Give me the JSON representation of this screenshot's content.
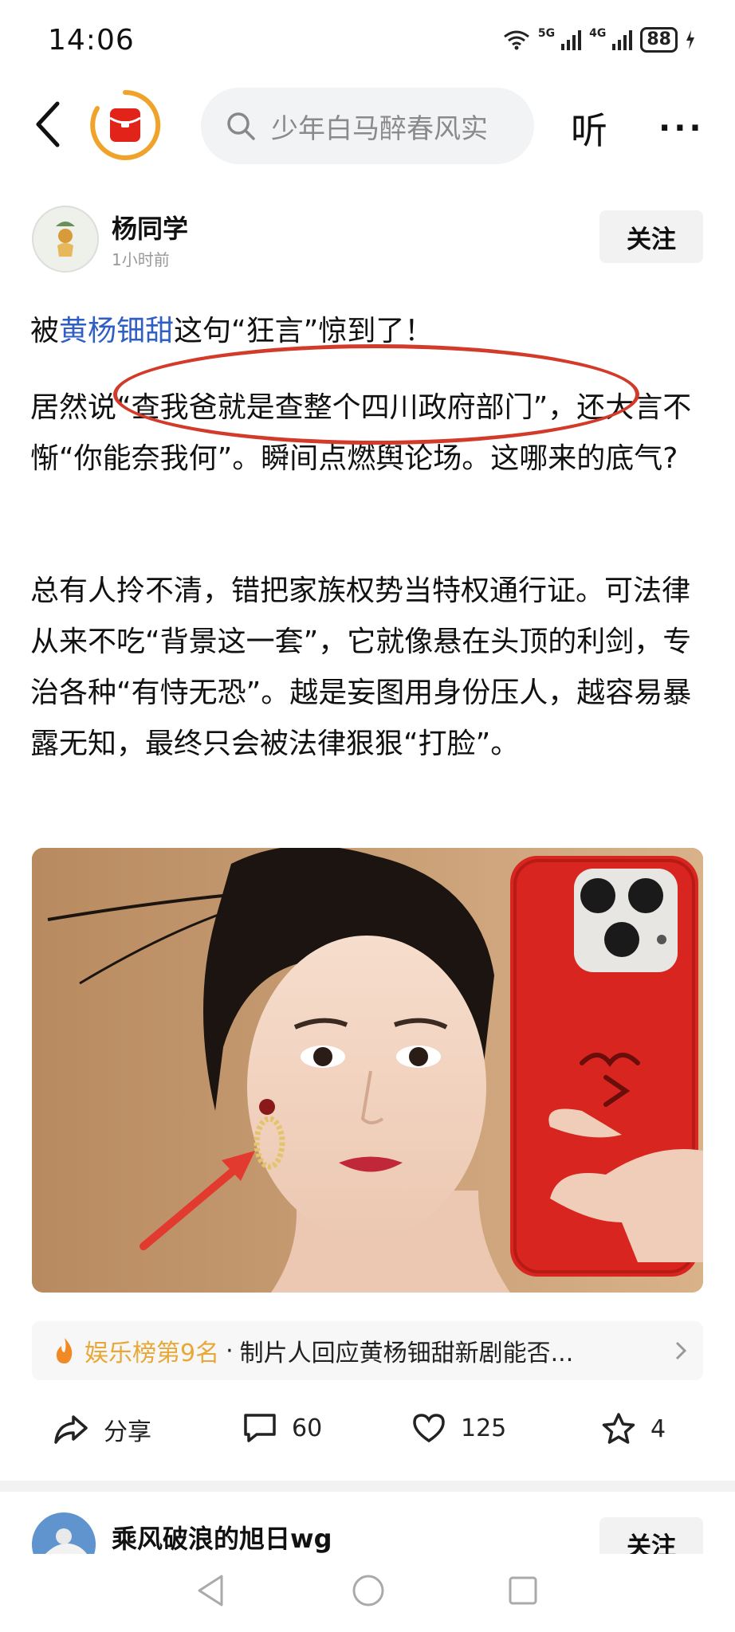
{
  "status": {
    "time": "14:06",
    "net1": "5G",
    "net2": "4G",
    "battery": "88"
  },
  "header": {
    "search_placeholder": "少年白马醉春风实",
    "listen_label": "听",
    "more_label": "···"
  },
  "post": {
    "author": "杨同学",
    "time": "1小时前",
    "follow_label": "关注",
    "p1": {
      "a": "被",
      "link": "黄杨钿甜",
      "b": "这句“狂言”惊到了！"
    },
    "p2": "居然说“查我爸就是查整个四川政府部门”，还大言不惭“你能奈我何”。瞬间点燃舆论场。这哪来的底气?",
    "p3": "总有人拎不清，错把家族权势当特权通行证。可法律从来不吃“背景这一套”，它就像悬在头顶的利剑，专治各种“有恃无恐”。越是妄图用身份压人，越容易暴露无知，最终只会被法律狠狠“打脸”。",
    "ranking": {
      "label": "娱乐榜第9名",
      "sep": "·",
      "text": "制片人回应黄杨钿甜新剧能否..."
    },
    "actions": {
      "share": "分享",
      "comments": "60",
      "likes": "125",
      "favorites": "4"
    }
  },
  "next_post": {
    "author": "乘风破浪的旭日wg",
    "follow_label": "关注"
  },
  "colors": {
    "accent_blue": "#2f5ec4",
    "highlight_red": "#d23a2a",
    "rank_orange": "#e8a838",
    "phone_red": "#d8251f"
  }
}
